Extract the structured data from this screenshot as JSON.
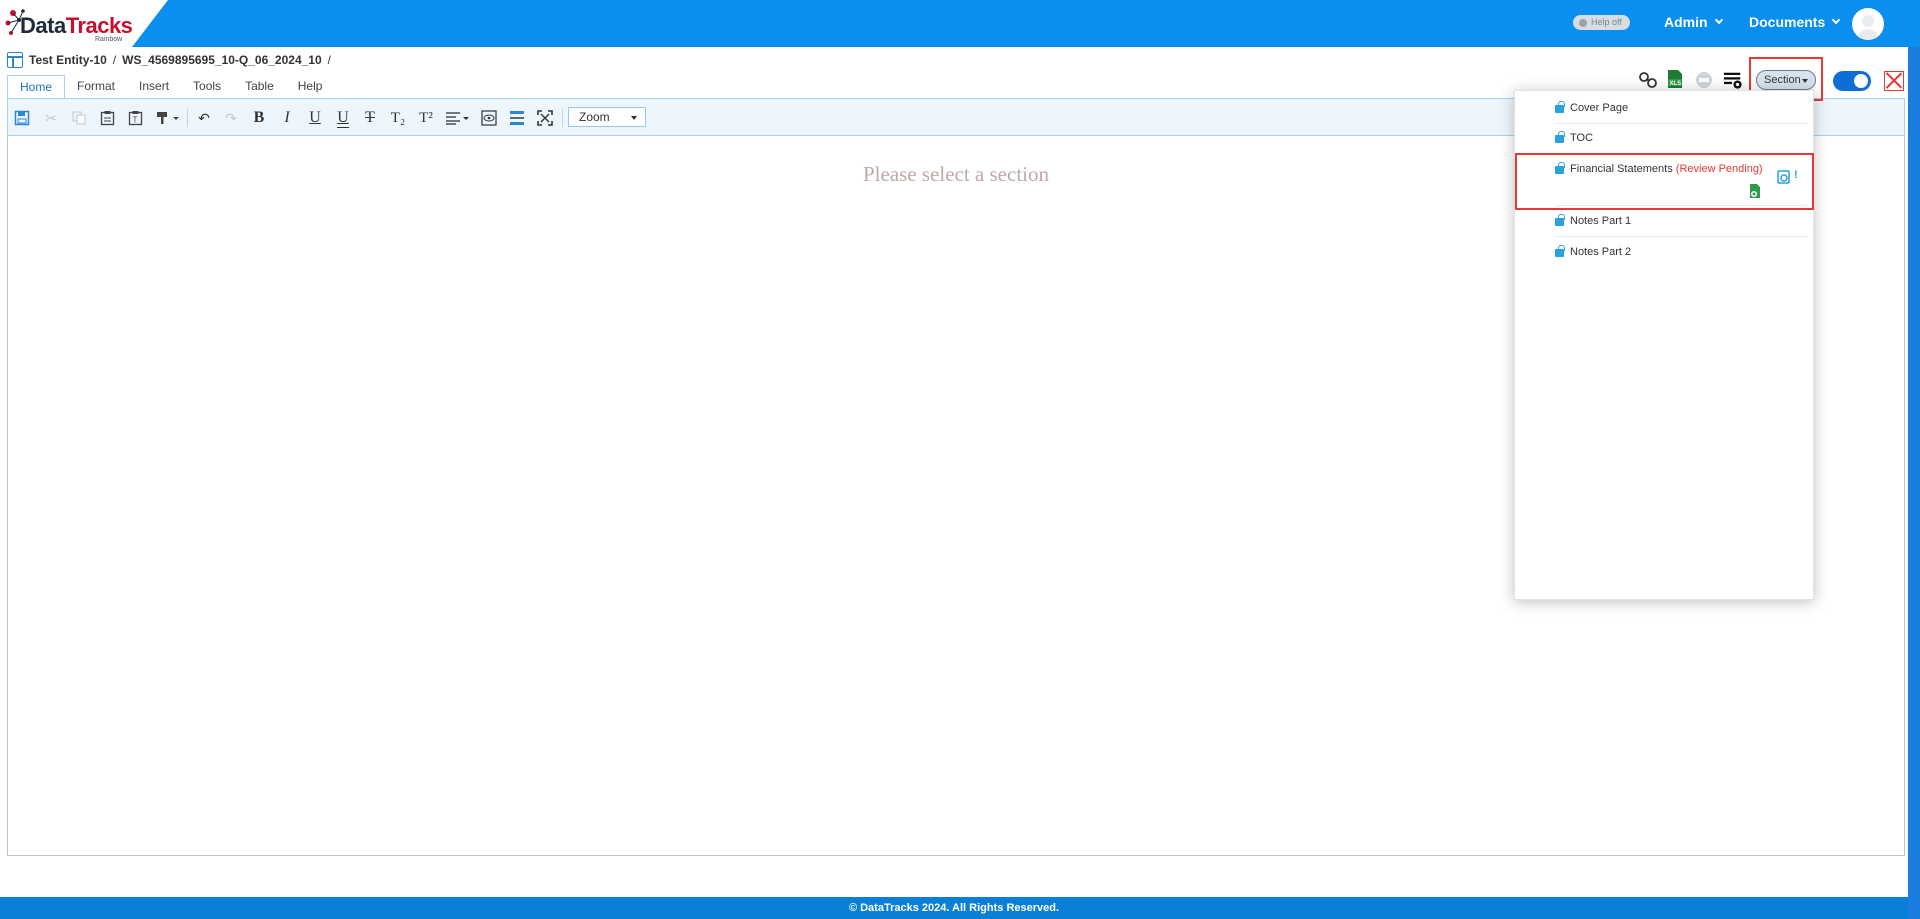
{
  "app": {
    "logo_text_main": "Data",
    "logo_text_accent": "Tracks",
    "logo_sub": "Rainbow"
  },
  "header": {
    "help_toggle": "Help off",
    "admin_label": "Admin",
    "documents_label": "Documents"
  },
  "breadcrumb": {
    "entity": "Test Entity-10",
    "separator": "/",
    "document": "WS_4569895695_10-Q_06_2024_10",
    "trailing": "/"
  },
  "menu_tabs": [
    {
      "label": "Home",
      "active": true
    },
    {
      "label": "Format"
    },
    {
      "label": "Insert"
    },
    {
      "label": "Tools"
    },
    {
      "label": "Table"
    },
    {
      "label": "Help"
    }
  ],
  "toolbar": {
    "bold": "B",
    "italic": "I",
    "underline": "U",
    "double_underline": "U",
    "strikethrough": "T",
    "subscript": "T₂",
    "superscript": "T²",
    "zoom_label": "Zoom"
  },
  "editor": {
    "placeholder": "Please select a section"
  },
  "section_selector": {
    "label": "Section"
  },
  "sections": [
    {
      "name": "Cover Page"
    },
    {
      "name": "TOC"
    },
    {
      "name": "Financial Statements",
      "status": "(Review Pending)",
      "alert": "!"
    },
    {
      "name": "Notes Part 1"
    },
    {
      "name": "Notes Part 2"
    }
  ],
  "footer": {
    "copyright": "© DataTracks 2024. All Rights Reserved."
  },
  "colors": {
    "topbar": "#0a8ef0",
    "accent_red": "#e53935",
    "footer": "#0a7fd8"
  }
}
